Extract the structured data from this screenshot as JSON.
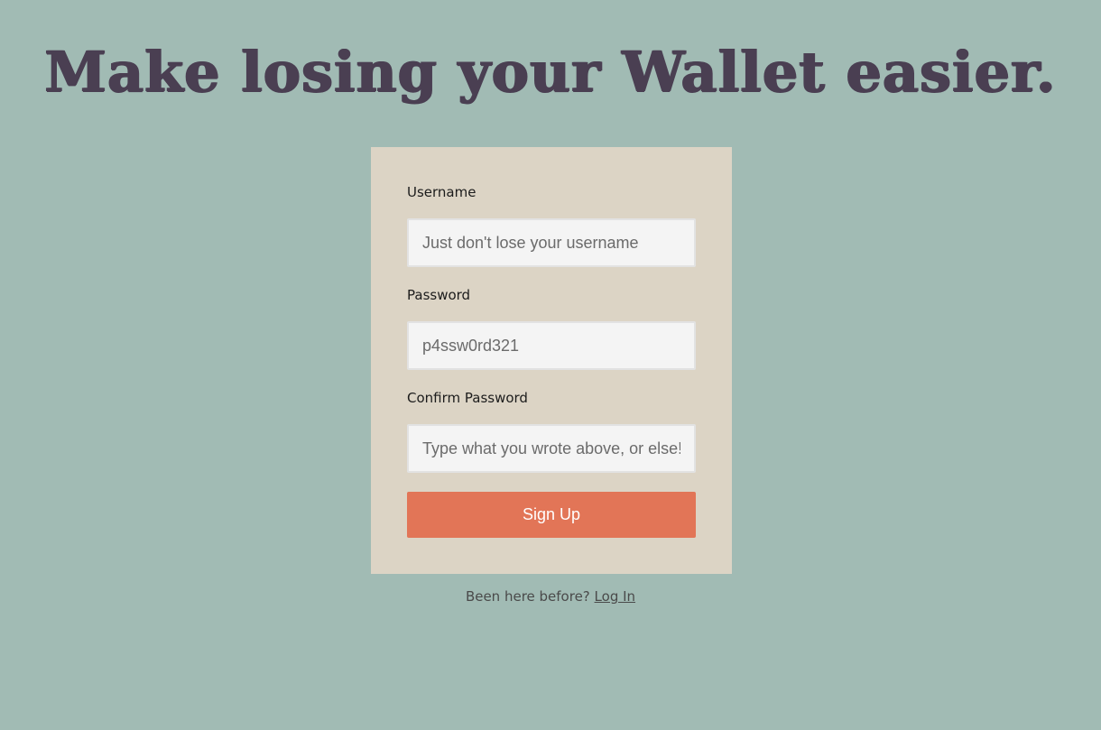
{
  "header": {
    "title": "Make losing your Wallet easier."
  },
  "form": {
    "username": {
      "label": "Username",
      "placeholder": "Just don't lose your username"
    },
    "password": {
      "label": "Password",
      "placeholder": "p4ssw0rd321"
    },
    "confirm_password": {
      "label": "Confirm Password",
      "placeholder": "Type what you wrote above, or else!"
    },
    "submit_label": "Sign Up"
  },
  "footer": {
    "prompt": "Been here before?",
    "login_label": "Log In"
  },
  "colors": {
    "background": "#a1bbb4",
    "card": "#dcd4c5",
    "title": "#4a3f52",
    "button": "#e27557"
  }
}
